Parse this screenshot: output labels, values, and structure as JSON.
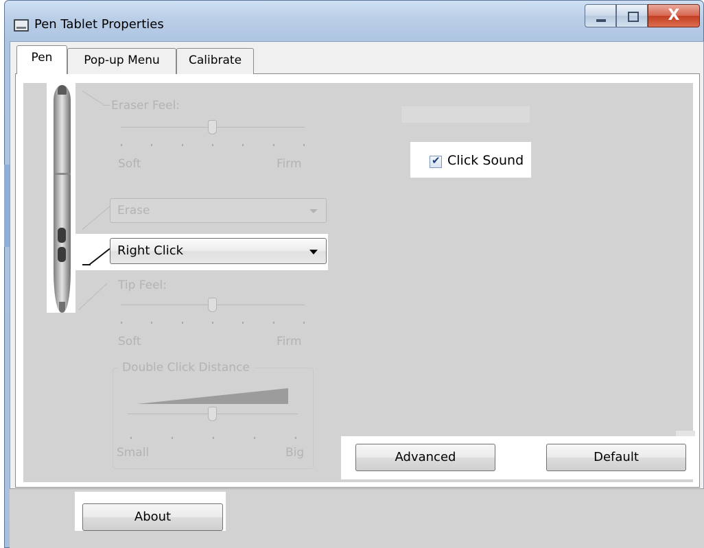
{
  "window": {
    "title": "Pen Tablet Properties",
    "close_glyph": "X"
  },
  "tabs": [
    {
      "label": "Pen",
      "active": true
    },
    {
      "label": "Pop-up Menu",
      "active": false
    },
    {
      "label": "Calibrate",
      "active": false
    }
  ],
  "eraser_feel": {
    "label": "Eraser Feel:",
    "min_label": "Soft",
    "max_label": "Firm",
    "level": 0.5,
    "enabled": false
  },
  "upper_button": {
    "value": "Erase",
    "enabled": false
  },
  "lower_button": {
    "value": "Right Click",
    "enabled": true
  },
  "tip_feel": {
    "label": "Tip Feel:",
    "min_label": "Soft",
    "max_label": "Firm",
    "level": 0.5,
    "enabled": false
  },
  "double_click_distance": {
    "label": "Double Click Distance",
    "min_label": "Small",
    "max_label": "Big",
    "level": 0.5,
    "enabled": false
  },
  "click_sound": {
    "label": "Click Sound",
    "checked": true
  },
  "buttons": {
    "advanced": "Advanced",
    "default": "Default",
    "about": "About"
  },
  "icons": {
    "app": "tablet-window-icon",
    "minimize": "minimize-icon",
    "maximize": "maximize-icon",
    "close": "close-icon",
    "pen": "pen-illustration",
    "dropdown": "chevron-down-icon",
    "check": "checkmark-icon"
  },
  "colors": {
    "panel": "#d2d2d2",
    "disabled_text": "#b3b3b3",
    "close_red": "#c23f22"
  }
}
